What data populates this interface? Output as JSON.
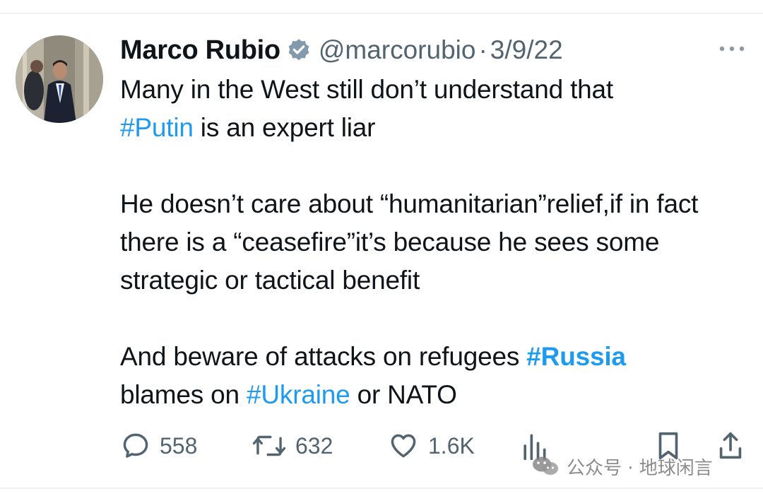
{
  "tweet": {
    "author": {
      "name": "Marco Rubio",
      "handle": "@marcorubio",
      "separator": "·",
      "date": "3/9/22",
      "verified_icon": "verified-badge-icon"
    },
    "body": {
      "line1": "Many in the West still don’t understand that",
      "hashtag_putin": "#Putin",
      "line2_rest": " is an expert liar",
      "para2": "He doesn’t care about “humanitarian”relief,if in fact there is a “ceasefire”it’s because he sees some strategic or tactical benefit",
      "para3_start": "And beware of attacks on refugees ",
      "hashtag_russia": "#Russia",
      "para3_mid": "blames on ",
      "hashtag_ukraine": "#Ukraine",
      "para3_end": " or NATO"
    },
    "actions": {
      "reply": {
        "icon": "reply-bubble-icon",
        "count": "558"
      },
      "retweet": {
        "icon": "retweet-icon",
        "count": "632"
      },
      "like": {
        "icon": "heart-icon",
        "count": "1.6K"
      },
      "views": {
        "icon": "bar-chart-icon"
      },
      "bookmark": {
        "icon": "bookmark-icon"
      },
      "share": {
        "icon": "share-upload-icon"
      }
    },
    "more_icon": "more-dots-icon"
  },
  "watermark": {
    "text": "公众号 · 地球闲言",
    "icon": "wechat-logo-icon"
  },
  "colors": {
    "link": "#1d9bf0",
    "text": "#0f1419",
    "secondary": "#536471",
    "verified": "#829aab"
  }
}
